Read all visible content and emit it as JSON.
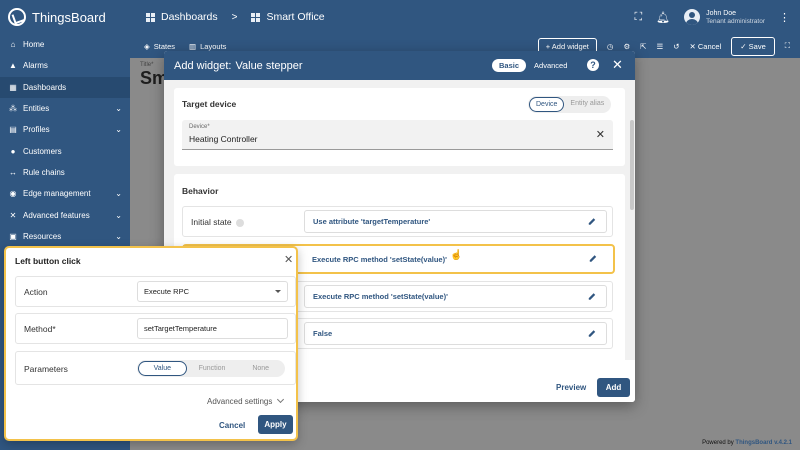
{
  "header": {
    "app_title": "ThingsBoard",
    "breadcrumb": [
      "Dashboards",
      "Smart Office"
    ],
    "user_name": "John Doe",
    "user_role": "Tenant administrator"
  },
  "sidebar": {
    "items": [
      {
        "label": "Home",
        "icon": "home-icon",
        "expandable": false
      },
      {
        "label": "Alarms",
        "icon": "alarm-icon",
        "expandable": false
      },
      {
        "label": "Dashboards",
        "icon": "dashboard-icon",
        "expandable": false,
        "active": true
      },
      {
        "label": "Entities",
        "icon": "entities-icon",
        "expandable": true
      },
      {
        "label": "Profiles",
        "icon": "profiles-icon",
        "expandable": true
      },
      {
        "label": "Customers",
        "icon": "customers-icon",
        "expandable": false
      },
      {
        "label": "Rule chains",
        "icon": "rule-chain-icon",
        "expandable": false
      },
      {
        "label": "Edge management",
        "icon": "edge-icon",
        "expandable": true
      },
      {
        "label": "Advanced features",
        "icon": "advanced-icon",
        "expandable": true
      },
      {
        "label": "Resources",
        "icon": "resources-icon",
        "expandable": true
      }
    ]
  },
  "dashbar": {
    "states": "States",
    "layouts": "Layouts",
    "add_widget": "+ Add widget",
    "cancel": "Cancel",
    "save": "Save"
  },
  "dashboard": {
    "title_label": "Title*",
    "title_value": "Sm"
  },
  "dialog": {
    "title_prefix": "Add widget:",
    "title_name": "Value stepper",
    "mode_basic": "Basic",
    "mode_advanced": "Advanced",
    "target_device_title": "Target device",
    "target_device_mode_device": "Device",
    "target_device_mode_alias": "Entity alias",
    "device_label": "Device*",
    "device_value": "Heating Controller",
    "behavior_title": "Behavior",
    "initial_state_label": "Initial state",
    "initial_state_value": "Use attribute 'targetTemperature'",
    "left_click_value": "Execute RPC method 'setState(value)'",
    "right_click_value": "Execute RPC method 'setState(value)'",
    "disabled_value": "False",
    "preview": "Preview",
    "add": "Add"
  },
  "popover": {
    "title": "Left button click",
    "action_label": "Action",
    "action_value": "Execute RPC",
    "method_label": "Method*",
    "method_value": "setTargetTemperature",
    "parameters_label": "Parameters",
    "parameters_options": [
      "Value",
      "Function",
      "None"
    ],
    "parameters_selected": "Value",
    "advanced_settings": "Advanced settings",
    "cancel": "Cancel",
    "apply": "Apply"
  },
  "footer": {
    "powered_prefix": "Powered by",
    "powered_brand": "ThingsBoard v.4.2.1"
  },
  "colors": {
    "primary": "#305680",
    "highlight": "#f3c24a"
  }
}
